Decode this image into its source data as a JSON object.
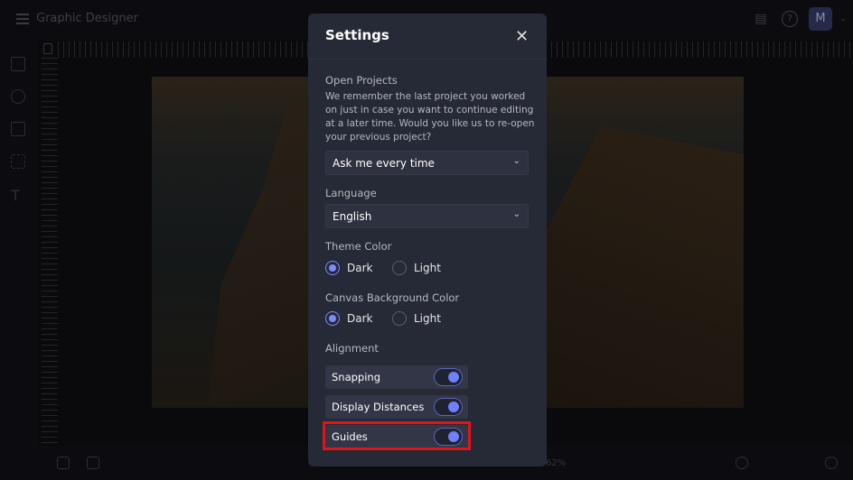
{
  "app": {
    "title": "Graphic Designer",
    "avatar_initial": "M",
    "zoom_level": "62%"
  },
  "settings": {
    "title": "Settings",
    "open_projects": {
      "label": "Open Projects",
      "description": "We remember the last project you worked on just in case you want to continue editing at a later time. Would you like us to re-open your previous project?",
      "value": "Ask me every time"
    },
    "language": {
      "label": "Language",
      "value": "English"
    },
    "theme_color": {
      "label": "Theme Color",
      "options": [
        "Dark",
        "Light"
      ],
      "selected": "Dark"
    },
    "canvas_background": {
      "label": "Canvas Background Color",
      "options": [
        "Dark",
        "Light"
      ],
      "selected": "Dark"
    },
    "alignment": {
      "label": "Alignment",
      "toggles": [
        {
          "label": "Snapping",
          "on": true
        },
        {
          "label": "Display Distances",
          "on": true
        },
        {
          "label": "Guides",
          "on": true
        }
      ]
    }
  },
  "colors": {
    "accent": "#6e80ff",
    "highlight": "#e0141b",
    "modal_bg": "#262a36"
  }
}
